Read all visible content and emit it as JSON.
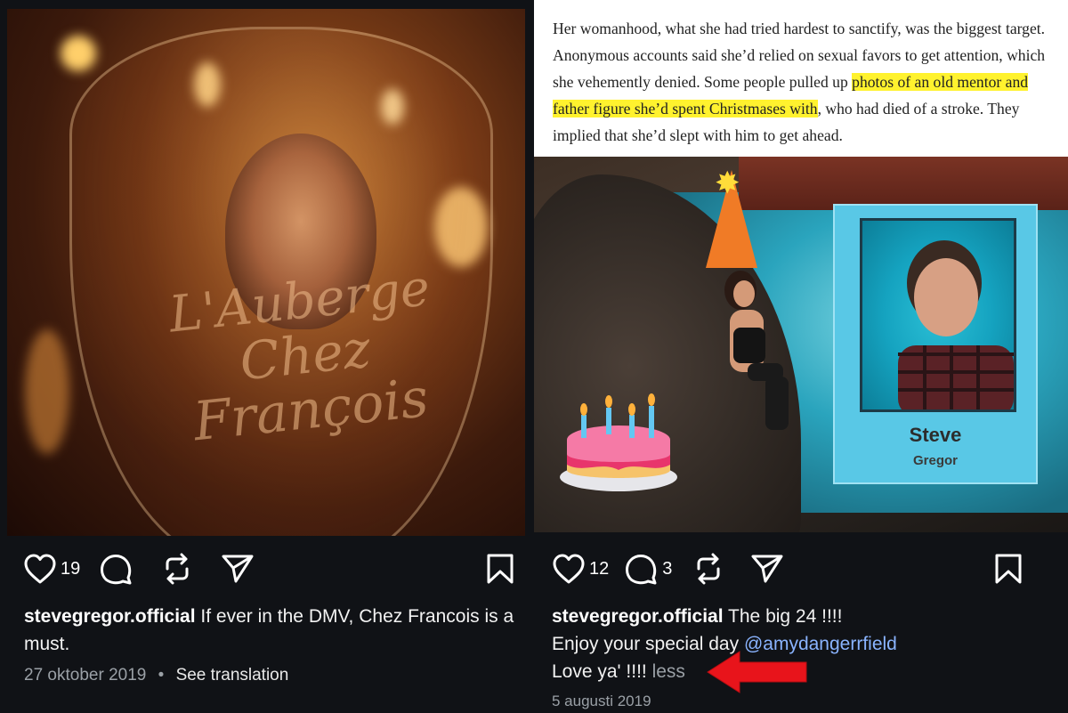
{
  "left_post": {
    "image_text": {
      "line1": "L'Auberge",
      "line2": "Chez",
      "line3": "François"
    },
    "likes": "19",
    "username": "stevegregor.official",
    "caption": "If ever in the DMV, Chez Francois is a must.",
    "date": "27 oktober 2019",
    "separator": "•",
    "see_translation": "See translation"
  },
  "right_post": {
    "article": {
      "before_highlight": "Her womanhood, what she had tried hardest to sanctify, was the biggest target. Anonymous accounts said she’d relied on sexual favors to get attention, which she vehemently denied. Some people pulled up ",
      "highlight": "photos of an old mentor and father figure she’d spent Christmases with",
      "after_highlight": ", who had died of a stroke. They implied that she’d slept with him to get ahead."
    },
    "card": {
      "name": "Steve",
      "surname": "Gregor"
    },
    "likes": "12",
    "comments": "3",
    "username": "stevegregor.official",
    "caption_line1": "The big 24 !!!!",
    "caption_line2": "Enjoy your special day ",
    "mention": "@amydangerrfield",
    "caption_line3": "Love ya' !!!! ",
    "less": "less",
    "date": "5 augusti 2019"
  },
  "colors": {
    "background": "#101216",
    "mention": "#8ab4ff",
    "highlight": "#fff22e",
    "arrow": "#e8141b",
    "card": "#59c8e6"
  },
  "icons": [
    "heart-icon",
    "comment-icon",
    "repost-icon",
    "share-icon",
    "bookmark-icon",
    "arrow-icon"
  ]
}
